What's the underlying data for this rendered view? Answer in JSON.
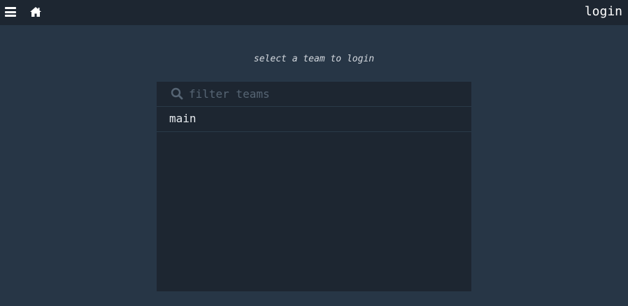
{
  "header": {
    "menu_icon": "hamburger-menu-icon",
    "home_icon": "home-icon",
    "login_label": "login"
  },
  "main": {
    "subtitle": "select a team to login",
    "search": {
      "icon": "search-icon",
      "placeholder": "filter teams",
      "value": ""
    },
    "teams": [
      {
        "label": "main"
      }
    ]
  },
  "colors": {
    "page_background": "#273646",
    "bar_background": "#1d2631",
    "text": "#ffffff",
    "muted": "#566574"
  }
}
